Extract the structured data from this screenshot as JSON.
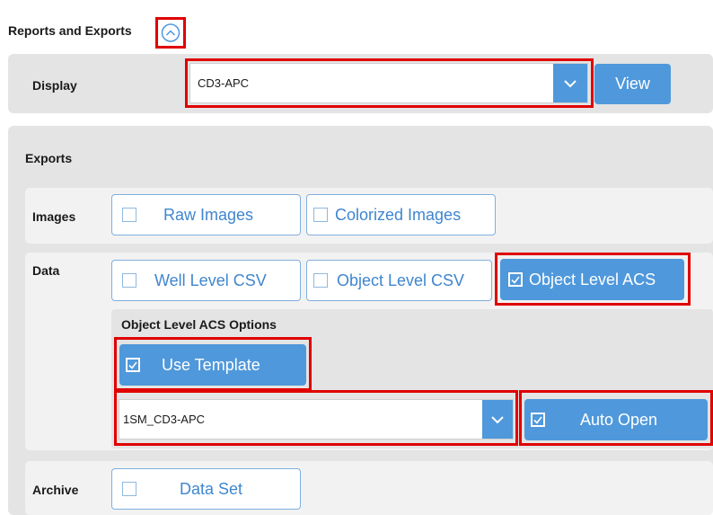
{
  "header": {
    "title": "Reports and Exports",
    "collapse_icon": "chevron-up-circle-icon"
  },
  "display": {
    "label": "Display",
    "selected": "CD3-APC",
    "view_label": "View"
  },
  "exports": {
    "title": "Exports",
    "images": {
      "label": "Images",
      "raw_images": "Raw Images",
      "colorized_images": "Colorized Images"
    },
    "data": {
      "label": "Data",
      "well_level_csv": "Well Level CSV",
      "object_level_csv": "Object Level CSV",
      "object_level_acs": "Object Level ACS",
      "options": {
        "title": "Object Level ACS Options",
        "use_template": "Use Template",
        "template_selected": "1SM_CD3-APC",
        "auto_open": "Auto Open"
      }
    },
    "archive": {
      "label": "Archive",
      "data_set": "Data Set"
    }
  },
  "colors": {
    "accent": "#4f98db",
    "highlight": "#e00000",
    "panel": "#e4e4e4"
  }
}
